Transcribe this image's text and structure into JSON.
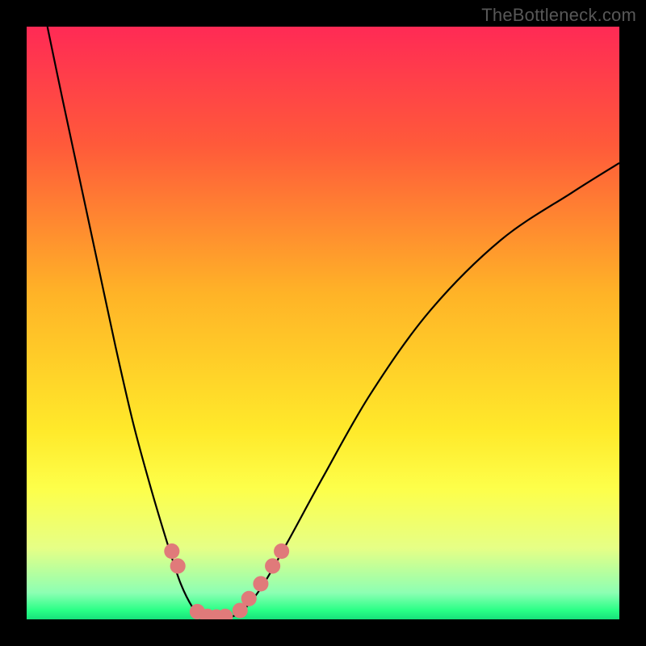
{
  "watermark": "TheBottleneck.com",
  "chart_data": {
    "type": "line",
    "title": "",
    "xlabel": "",
    "ylabel": "",
    "xlim": [
      0,
      100
    ],
    "ylim": [
      0,
      100
    ],
    "legend": false,
    "grid": false,
    "background_gradient": {
      "stops": [
        {
          "pos": 0.0,
          "color": "#ff2a55"
        },
        {
          "pos": 0.2,
          "color": "#ff5a3a"
        },
        {
          "pos": 0.45,
          "color": "#ffb327"
        },
        {
          "pos": 0.68,
          "color": "#ffe92a"
        },
        {
          "pos": 0.78,
          "color": "#fdff4a"
        },
        {
          "pos": 0.88,
          "color": "#e6ff86"
        },
        {
          "pos": 0.955,
          "color": "#8dffb3"
        },
        {
          "pos": 0.985,
          "color": "#29ff86"
        },
        {
          "pos": 1.0,
          "color": "#17e07a"
        }
      ]
    },
    "series": [
      {
        "name": "bottleneck-curve",
        "stroke": "#000000",
        "stroke_width": 2.2,
        "x": [
          3.5,
          6,
          9,
          12,
          15,
          18,
          21,
          24,
          26,
          28,
          29.5,
          31,
          33,
          35,
          37,
          40,
          44,
          50,
          58,
          68,
          80,
          92,
          100
        ],
        "y": [
          100,
          88,
          74,
          60,
          46,
          33,
          22,
          12,
          6,
          2,
          0.4,
          0.2,
          0.2,
          0.6,
          2,
          6,
          13,
          24,
          38,
          52,
          64,
          72,
          77
        ]
      }
    ],
    "markers": {
      "name": "bottleneck-threshold-markers",
      "color": "#e07a7a",
      "radius_pct": 1.3,
      "points": [
        {
          "x": 24.5,
          "y": 11.5
        },
        {
          "x": 25.5,
          "y": 9.0
        },
        {
          "x": 28.8,
          "y": 1.3
        },
        {
          "x": 30.5,
          "y": 0.5
        },
        {
          "x": 32.0,
          "y": 0.4
        },
        {
          "x": 33.5,
          "y": 0.5
        },
        {
          "x": 36.0,
          "y": 1.5
        },
        {
          "x": 37.5,
          "y": 3.5
        },
        {
          "x": 39.5,
          "y": 6.0
        },
        {
          "x": 41.5,
          "y": 9.0
        },
        {
          "x": 43.0,
          "y": 11.5
        }
      ]
    }
  }
}
